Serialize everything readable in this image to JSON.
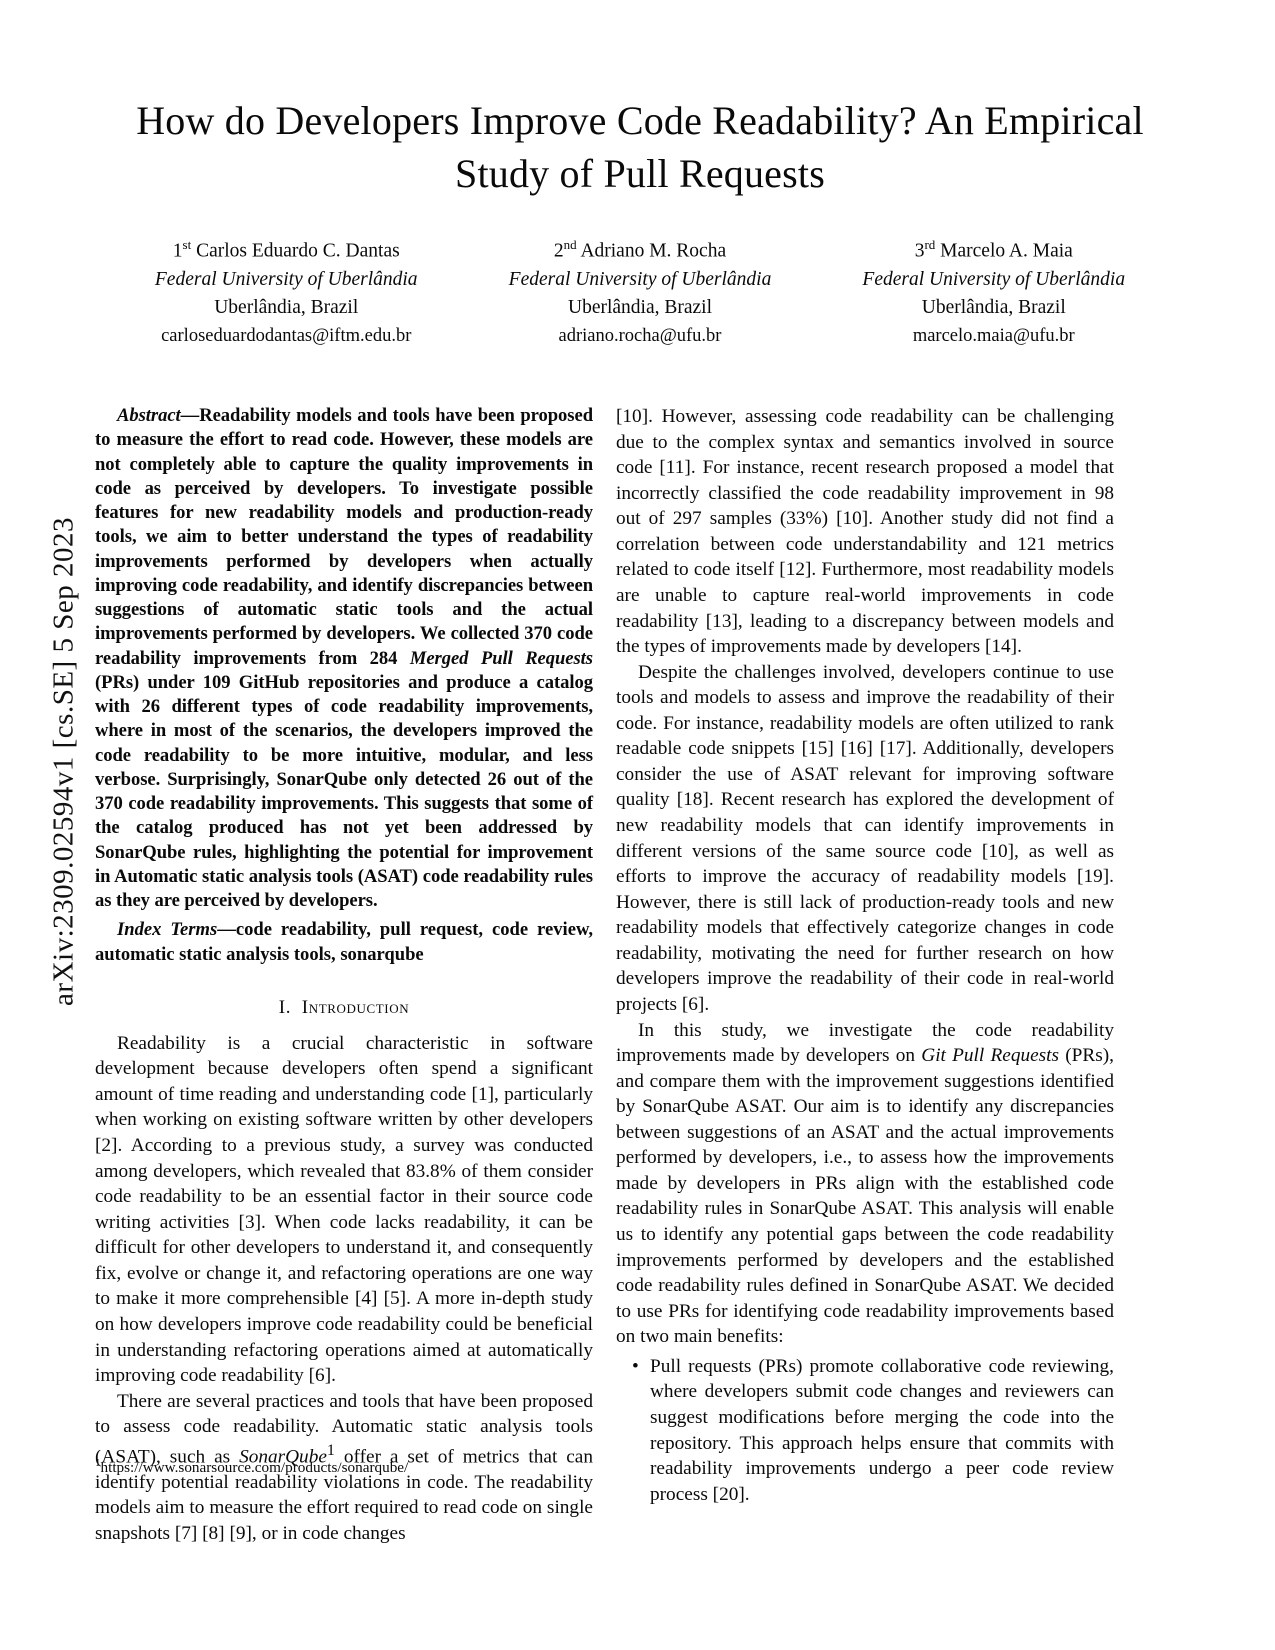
{
  "arxiv_stamp": "arXiv:2309.02594v1  [cs.SE]  5 Sep 2023",
  "title": "How do Developers Improve Code Readability? An Empirical Study of Pull Requests",
  "authors": [
    {
      "order": "1",
      "order_suffix": "st",
      "name": "Carlos Eduardo C. Dantas",
      "affiliation": "Federal University of Uberlândia",
      "city": "Uberlândia, Brazil",
      "email": "carloseduardodantas@iftm.edu.br"
    },
    {
      "order": "2",
      "order_suffix": "nd",
      "name": "Adriano M. Rocha",
      "affiliation": "Federal University of Uberlândia",
      "city": "Uberlândia, Brazil",
      "email": "adriano.rocha@ufu.br"
    },
    {
      "order": "3",
      "order_suffix": "rd",
      "name": "Marcelo A. Maia",
      "affiliation": "Federal University of Uberlândia",
      "city": "Uberlândia, Brazil",
      "email": "marcelo.maia@ufu.br"
    }
  ],
  "abstract": {
    "lead_label": "Abstract",
    "dash": "—",
    "text_part1": "Readability models and tools have been proposed to measure the effort to read code. However, these models are not completely able to capture the quality improvements in code as perceived by developers. To investigate possible features for new readability models and production-ready tools, we aim to better understand the types of readability improvements performed by developers when actually improving code readability, and identify discrepancies between suggestions of automatic static tools and the actual improvements performed by developers. We collected 370 code readability improvements from 284 ",
    "italic1": "Merged Pull Requests",
    "text_part2": " (PRs) under 109 GitHub repositories and produce a catalog with 26 different types of code readability improvements, where in most of the scenarios, the developers improved the code readability to be more intuitive, modular, and less verbose. Surprisingly, SonarQube only detected 26 out of the 370 code readability improvements. This suggests that some of the catalog produced has not yet been addressed by SonarQube rules, highlighting the potential for improvement in Automatic static analysis tools (ASAT) code readability rules as they are perceived by developers."
  },
  "index_terms": {
    "lead_label": "Index Terms",
    "dash": "—",
    "text": "code readability, pull request, code review, automatic static analysis tools, sonarqube"
  },
  "sections": {
    "introduction_number": "I.",
    "introduction_title": "Introduction"
  },
  "left_column": {
    "p1": {
      "t1": "Readability is a crucial characteristic in software development because developers often spend a significant amount of time reading and understanding code ",
      "c1": "[1]",
      "t2": ", particularly when working on existing software written by other developers ",
      "c2": "[2]",
      "t3": ". According to a previous study, a survey was conducted among developers, which revealed that 83.8% of them consider code readability to be an essential factor in their source code writing activities ",
      "c3": "[3]",
      "t4": ". When code lacks readability, it can be difficult for other developers to understand it, and consequently fix, evolve or change it, and refactoring operations are one way to make it more comprehensible ",
      "c4": "[4]",
      "t5": " ",
      "c5": "[5]",
      "t6": ". A more in-depth study on how developers improve code readability could be beneficial in understanding refactoring operations aimed at automatically improving code readability ",
      "c6": "[6]",
      "t7": "."
    },
    "p2": {
      "t1": "There are several practices and tools that have been proposed to assess code readability. Automatic static analysis tools (ASAT), such as ",
      "it1": "SonarQube",
      "sup1": "1",
      "t2": " offer a set of metrics that can identify potential readability violations in code. The readability models aim to measure the effort required to read code on single snapshots ",
      "c1": "[7]",
      "t3": " ",
      "c2": "[8]",
      "t4": " ",
      "c3": "[9]",
      "t5": ", or in code changes"
    }
  },
  "right_column": {
    "p1": {
      "c0": "[10]",
      "t1": ". However, assessing code readability can be challenging due to the complex syntax and semantics involved in source code ",
      "c1": "[11]",
      "t2": ". For instance, recent research proposed a model that incorrectly classified the code readability improvement in 98 out of 297 samples (33%) ",
      "c2": "[10]",
      "t3": ". Another study did not find a correlation between code understandability and 121 metrics related to code itself ",
      "c3": "[12]",
      "t4": ". Furthermore, most readability models are unable to capture real-world improvements in code readability ",
      "c4": "[13]",
      "t5": ", leading to a discrepancy between models and the types of improvements made by developers ",
      "c5": "[14]",
      "t6": "."
    },
    "p2": {
      "t1": "Despite the challenges involved, developers continue to use tools and models to assess and improve the readability of their code. For instance, readability models are often utilized to rank readable code snippets ",
      "c1": "[15]",
      "t2": " ",
      "c2": "[16]",
      "t3": " ",
      "c3": "[17]",
      "t4": ". Additionally, developers consider the use of ASAT relevant for improving software quality ",
      "c4": "[18]",
      "t5": ". Recent research has explored the development of new readability models that can identify improvements in different versions of the same source code ",
      "c5": "[10]",
      "t6": ", as well as efforts to improve the accuracy of readability models ",
      "c6": "[19]",
      "t7": ". However, there is still lack of production-ready tools and new readability models that effectively categorize changes in code readability, motivating the need for further research on how developers improve the readability of their code in real-world projects ",
      "c7": "[6]",
      "t8": "."
    },
    "p3": {
      "t1": "In this study, we investigate the code readability improvements made by developers on ",
      "it1": "Git Pull Requests",
      "t2": " (PRs), and compare them with the improvement suggestions identified by SonarQube ASAT. Our aim is to identify any discrepancies between suggestions of an ASAT and the actual improvements performed by developers, i.e., to assess how the improvements made by developers in PRs align with the established code readability rules in SonarQube ASAT. This analysis will enable us to identify any potential gaps between the code readability improvements performed by developers and the established code readability rules defined in SonarQube ASAT. We decided to use PRs for identifying code readability improvements based on two main benefits:"
    },
    "bullet1": {
      "t1": "Pull requests (PRs) promote collaborative code reviewing, where developers submit code changes and reviewers can suggest modifications before merging the code into the repository. This approach helps ensure that commits with readability improvements undergo a peer code review process ",
      "c1": "[20]",
      "t2": "."
    }
  },
  "footnote": {
    "marker": "1",
    "url": "https://www.sonarsource.com/products/sonarqube/"
  }
}
